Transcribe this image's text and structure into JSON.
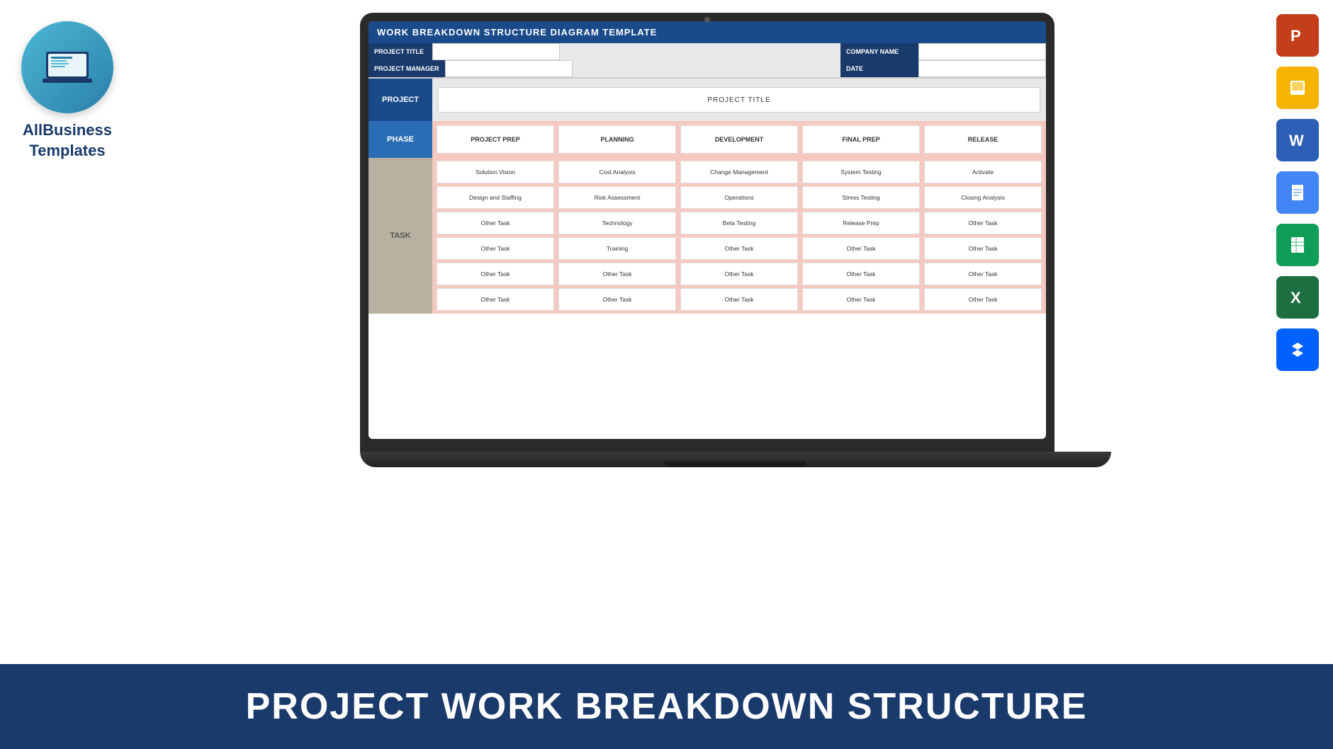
{
  "logo": {
    "brand_line1": "AllBusiness",
    "brand_line2": "Templates"
  },
  "bottom_banner": {
    "text": "PROJECT WORK BREAKDOWN STRUCTURE"
  },
  "wbs": {
    "title": "WORK BREAKDOWN STRUCTURE DIAGRAM TEMPLATE",
    "fields": {
      "project_title_label": "PROJECT TITLE",
      "project_manager_label": "PROJECT MANAGER",
      "company_name_label": "COMPANY NAME",
      "date_label": "DATE"
    },
    "project_label": "PROJECT",
    "project_title": "PROJECT TITLE",
    "phase_label": "PHASE",
    "phases": [
      "PROJECT PREP",
      "PLANNING",
      "DEVELOPMENT",
      "FINAL PREP",
      "RELEASE"
    ],
    "task_label": "TASK",
    "task_rows": [
      [
        "Solution Vision",
        "Cost Analysis",
        "Change Management",
        "System Testing",
        "Activate"
      ],
      [
        "Design and Staffing",
        "Risk Assessment",
        "Operations",
        "Stress Testing",
        "Closing Analysis"
      ],
      [
        "Other Task",
        "Technology",
        "Beta Testing",
        "Release Prep",
        "Other Task"
      ],
      [
        "Other Task",
        "Training",
        "Other Task",
        "Other Task",
        "Other Task"
      ],
      [
        "Other Task",
        "Other Task",
        "Other Task",
        "Other Task",
        "Other Task"
      ],
      [
        "Other Task",
        "Other Task",
        "Other Task",
        "Other Task",
        "Other Task"
      ]
    ]
  },
  "app_icons": [
    {
      "name": "PowerPoint",
      "class": "icon-ppt",
      "symbol": "P"
    },
    {
      "name": "Google Slides",
      "class": "icon-slides",
      "symbol": "▶"
    },
    {
      "name": "Word",
      "class": "icon-word",
      "symbol": "W"
    },
    {
      "name": "Google Docs",
      "class": "icon-docs",
      "symbol": "≡"
    },
    {
      "name": "Google Sheets",
      "class": "icon-sheets",
      "symbol": "⊞"
    },
    {
      "name": "Excel",
      "class": "icon-excel",
      "symbol": "X"
    },
    {
      "name": "Dropbox",
      "class": "icon-dropbox",
      "symbol": "❖"
    }
  ]
}
